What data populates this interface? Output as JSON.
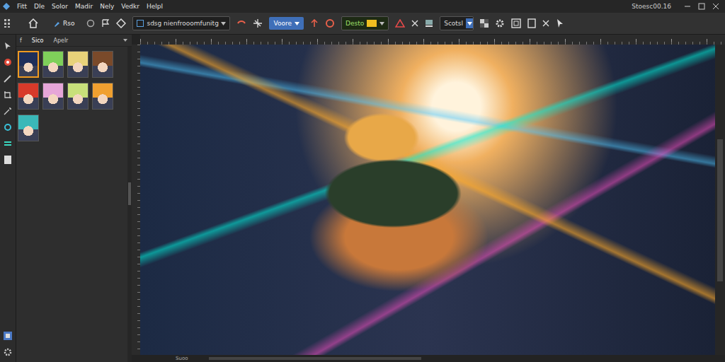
{
  "window": {
    "version": "Stoesc00.16"
  },
  "menu": {
    "items": [
      "Fitt",
      "Dle",
      "Solor",
      "Madir",
      "Nely",
      "Vedkr",
      "Helpl"
    ]
  },
  "toolbar": {
    "home_label": "Rso",
    "path_field": "sdsg nienfrooomfunitg",
    "mode_select": "Voore",
    "color_field": "Desto",
    "preset_select": "Scotsl"
  },
  "panel": {
    "tabs": [
      {
        "label": "f",
        "selected": false
      },
      {
        "label": "Sico",
        "selected": true
      },
      {
        "label": "Apelr",
        "selected": false
      }
    ],
    "thumbnails": [
      {
        "selected": true,
        "color": "#1f2f5a"
      },
      {
        "selected": false,
        "color": "#7fcf5a"
      },
      {
        "selected": false,
        "color": "#e8d27a"
      },
      {
        "selected": false,
        "color": "#7a4a2a"
      },
      {
        "selected": false,
        "color": "#d83a2a"
      },
      {
        "selected": false,
        "color": "#e6a6d8"
      },
      {
        "selected": false,
        "color": "#c8e07a"
      },
      {
        "selected": false,
        "color": "#f0a030"
      },
      {
        "selected": false,
        "color": "#3ab8b8"
      }
    ]
  },
  "status_bar": {
    "text": "Suoo"
  }
}
